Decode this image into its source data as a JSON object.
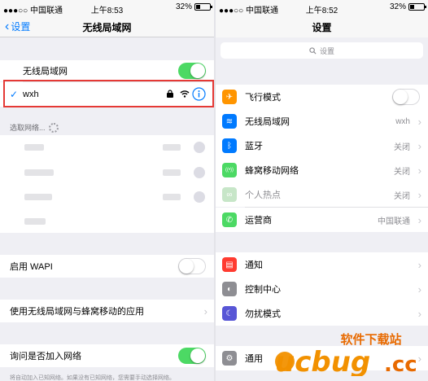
{
  "left": {
    "status": {
      "carrier": "●●●○○ 中国联通",
      "time": "上午8:53",
      "battery": "32%",
      "battery_level": 0.32
    },
    "nav": {
      "back": "设置",
      "title": "无线局域网"
    },
    "wifi_row": {
      "label": "无线局域网",
      "on": true
    },
    "connected": {
      "name": "wxh",
      "check": "✓"
    },
    "choose_header": "选取网络...",
    "wapi": {
      "label": "启用 WAPI",
      "on": false
    },
    "apps_row": {
      "label": "使用无线局域网与蜂窝移动的应用"
    },
    "ask_row": {
      "label": "询问是否加入网络",
      "on": true
    },
    "footnote": "将自动加入已知网络。如果没有已知网络，您需要手动选择网络。"
  },
  "right": {
    "status": {
      "carrier": "●●●○○ 中国联通",
      "time": "上午8:52",
      "battery": "32%",
      "battery_level": 0.32
    },
    "nav": {
      "title": "设置"
    },
    "search_placeholder": "设置",
    "items": [
      {
        "label": "飞行模式",
        "value": "",
        "icon": "airplane-icon",
        "color": "#ff9500"
      },
      {
        "label": "无线局域网",
        "value": "wxh",
        "icon": "wifi-icon",
        "color": "#007aff"
      },
      {
        "label": "蓝牙",
        "value": "关闭",
        "icon": "bluetooth-icon",
        "color": "#007aff"
      },
      {
        "label": "蜂窝移动网络",
        "value": "关闭",
        "icon": "cellular-icon",
        "color": "#4cd964"
      },
      {
        "label": "个人热点",
        "value": "关闭",
        "icon": "hotspot-icon",
        "color": "#c7e6c8"
      },
      {
        "label": "运营商",
        "value": "中国联通",
        "icon": "phone-icon",
        "color": "#4cd964"
      },
      {
        "label": "通知",
        "value": "",
        "icon": "notifications-icon",
        "color": "#ff3b30"
      },
      {
        "label": "控制中心",
        "value": "",
        "icon": "control-center-icon",
        "color": "#8e8e93"
      },
      {
        "label": "勿扰模式",
        "value": "",
        "icon": "moon-icon",
        "color": "#5856d6"
      },
      {
        "label": "通用",
        "value": "",
        "icon": "gear-icon",
        "color": "#8e8e93"
      }
    ]
  },
  "watermark": {
    "brand": "ucbug",
    "suffix": ".cc",
    "tagline": "软件下载站"
  }
}
